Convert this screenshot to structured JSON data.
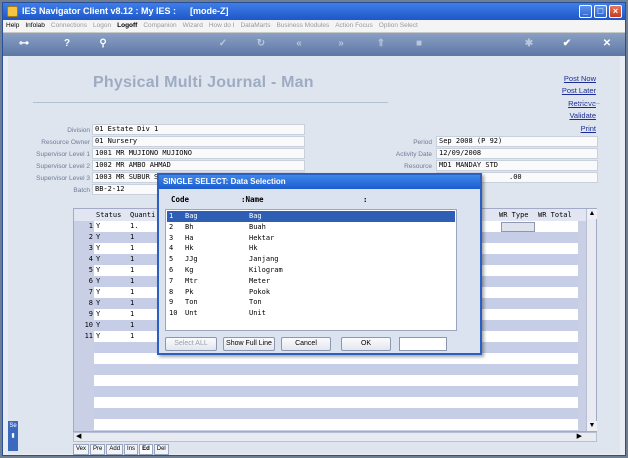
{
  "window": {
    "app_title": "IES Navigator Client v8.12 : My IES :",
    "mode_title": "[mode-Z]"
  },
  "menu": [
    {
      "label": "Help",
      "enabled": true
    },
    {
      "label": "Infolab",
      "enabled": true
    },
    {
      "label": "Connections",
      "enabled": false
    },
    {
      "label": "Logon",
      "enabled": false
    },
    {
      "label": "Logoff",
      "enabled": true,
      "bold": true
    },
    {
      "label": "Companion",
      "enabled": false
    },
    {
      "label": "Wizard",
      "enabled": false
    },
    {
      "label": "How do I",
      "enabled": false
    },
    {
      "label": "DataMarts",
      "enabled": false
    },
    {
      "label": "Business Modules",
      "enabled": false
    },
    {
      "label": "Action Focus",
      "enabled": false
    },
    {
      "label": "Option Select",
      "enabled": false
    }
  ],
  "page": {
    "heading": "Physical Multi Journal - Man"
  },
  "actions": {
    "post_now": "Post Now",
    "post_later": "Post Later",
    "retrieve": "Retrieve",
    "validate": "Validate",
    "print": "Print"
  },
  "fields": {
    "division_label": "Division",
    "division_value": "01 Estate Div 1",
    "resource_owner_label": "Resource Owner",
    "resource_owner_value": "01 Nursery",
    "sup1_label": "Supervisor Level 1",
    "sup1_value": "1001 MR MUJIONO MUJIONO",
    "sup2_label": "Supervisor Level 2",
    "sup2_value": "1002 MR AMBO AHMAD",
    "sup3_label": "Supervisor Level 3",
    "sup3_value": "1003 MR SUBUR S",
    "batch_label": "Batch",
    "batch_value": "BB-2-12",
    "period_label": "Period",
    "period_value": "Sep 2008 (P 92)",
    "activity_date_label": "Activity Date",
    "activity_date_value": "12/09/2008",
    "resource_label": "Resource",
    "resource_value": "MD1 MANDAY STD",
    "rate_value": ".00"
  },
  "grid": {
    "col_status": "Status",
    "col_quantity": "Quanti",
    "col_wr_type": "WR Type",
    "col_wr_total": "WR Total",
    "rows": [
      {
        "n": "1",
        "status": "Y",
        "qty": "1."
      },
      {
        "n": "2",
        "status": "Y",
        "qty": "1"
      },
      {
        "n": "3",
        "status": "Y",
        "qty": "1"
      },
      {
        "n": "4",
        "status": "Y",
        "qty": "1"
      },
      {
        "n": "5",
        "status": "Y",
        "qty": "1"
      },
      {
        "n": "6",
        "status": "Y",
        "qty": "1"
      },
      {
        "n": "7",
        "status": "Y",
        "qty": "1"
      },
      {
        "n": "8",
        "status": "Y",
        "qty": "1"
      },
      {
        "n": "9",
        "status": "Y",
        "qty": "1"
      },
      {
        "n": "10",
        "status": "Y",
        "qty": "1"
      },
      {
        "n": "11",
        "status": "Y",
        "qty": "1"
      }
    ]
  },
  "tabs": [
    "Vex",
    "Pre",
    "Add",
    "Ins",
    "Ed",
    "Del"
  ],
  "side_tab": "Se",
  "dialog": {
    "title": "SINGLE SELECT: Data Selection",
    "col_code": "Code",
    "col_name": ":Name",
    "col_colon": ":",
    "items": [
      {
        "n": "1",
        "code": "Bag",
        "name": "Bag"
      },
      {
        "n": "2",
        "code": "Bh",
        "name": "Buah"
      },
      {
        "n": "3",
        "code": "Ha",
        "name": "Hektar"
      },
      {
        "n": "4",
        "code": "Hk",
        "name": "Hk"
      },
      {
        "n": "5",
        "code": "JJg",
        "name": "Janjang"
      },
      {
        "n": "6",
        "code": "Kg",
        "name": "Kilogram"
      },
      {
        "n": "7",
        "code": "Mtr",
        "name": "Meter"
      },
      {
        "n": "8",
        "code": "Pk",
        "name": "Pokok"
      },
      {
        "n": "9",
        "code": "Ton",
        "name": "Ton"
      },
      {
        "n": "10",
        "code": "Unt",
        "name": "Unit"
      }
    ],
    "selected_index": 0,
    "btn_select_all": "Select ALL",
    "btn_show_full_line": "Show Full Line",
    "btn_cancel": "Cancel",
    "btn_ok": "OK",
    "search_value": ""
  }
}
